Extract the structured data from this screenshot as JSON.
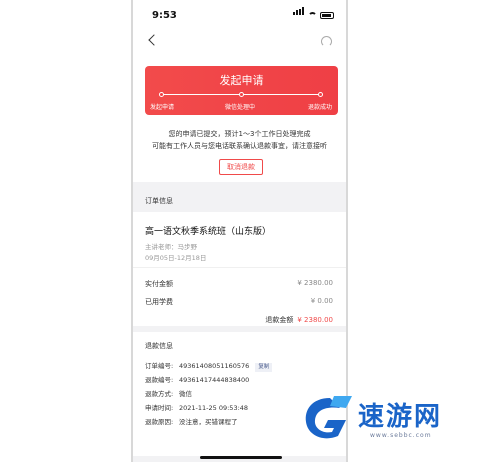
{
  "status_bar": {
    "time": "9:53"
  },
  "hero": {
    "banner_title": "发起申请",
    "steps": [
      "发起申请",
      "微信处理中",
      "退款成功"
    ],
    "notice_line1": "您的申请已提交，预计1～3个工作日处理完成",
    "notice_line2": "可能有工作人员与您电话联系确认退款事宜，请注意接听",
    "cancel_label": "取消退款"
  },
  "order": {
    "section_title": "订单信息",
    "course_title": "高一语文秋季系统班（山东版）",
    "teacher": "主讲老师：马步野",
    "dates": "09月05日-12月18日",
    "paid_label": "实付金额",
    "paid_value": "¥ 2380.00",
    "used_label": "已用学费",
    "used_value": "¥ 0.00",
    "refund_label": "退款金额",
    "refund_value": "¥ 2380.00"
  },
  "refund": {
    "section_title": "退款信息",
    "rows": [
      {
        "key": "订单编号:",
        "value": "49361408051160576"
      },
      {
        "key": "退款编号:",
        "value": "49361417444838400"
      },
      {
        "key": "退款方式:",
        "value": "微信"
      },
      {
        "key": "申请时间:",
        "value": "2021-11-25 09:53:48"
      },
      {
        "key": "退款原因:",
        "value": "没注意，买错课程了"
      }
    ],
    "copy_label": "复制"
  },
  "watermark": {
    "text": "速游网",
    "url": "www.sebbc.com"
  },
  "colors": {
    "accent": "#f04a4a",
    "brand_blue": "#1a64c8"
  }
}
